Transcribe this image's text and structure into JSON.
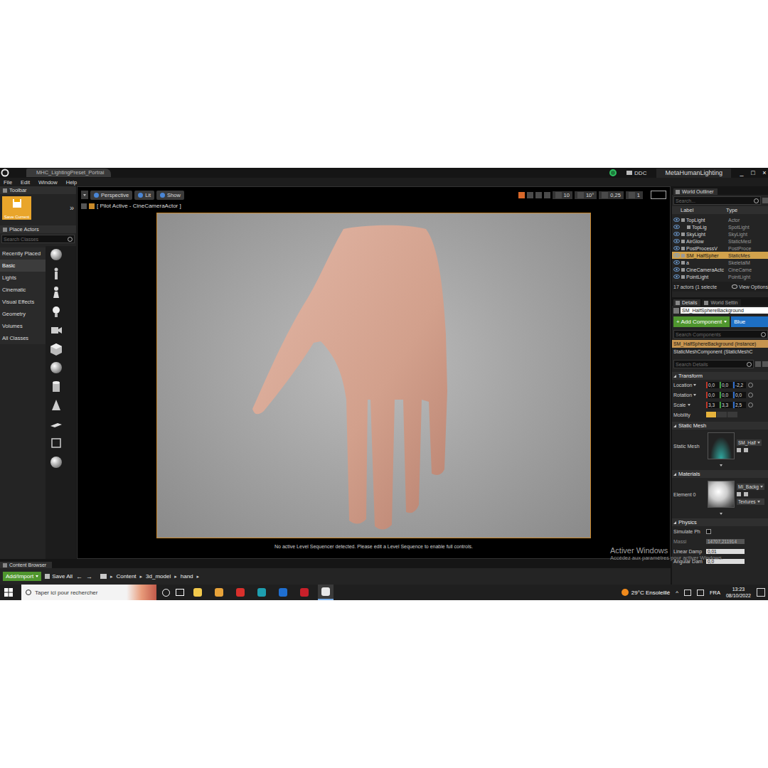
{
  "window": {
    "tab": "MHC_LightingPreset_Portrai",
    "ddc": "DDC",
    "project": "MetaHumanLighting",
    "controls": [
      "_",
      "□",
      "×"
    ]
  },
  "menu": [
    "File",
    "Edit",
    "Window",
    "Help"
  ],
  "left_panel": {
    "toolbar_title": "Toolbar",
    "save_label": "Save Current",
    "expand": "»",
    "place_title": "Place Actors",
    "search_placeholder": "Search Classes",
    "categories": [
      {
        "label": "Recently Placed",
        "selected": false
      },
      {
        "label": "Basic",
        "selected": true
      },
      {
        "label": "Lights",
        "selected": false
      },
      {
        "label": "Cinematic",
        "selected": false
      },
      {
        "label": "Visual Effects",
        "selected": false
      },
      {
        "label": "Geometry",
        "selected": false
      },
      {
        "label": "Volumes",
        "selected": false
      },
      {
        "label": "All Classes",
        "selected": false
      }
    ]
  },
  "viewport": {
    "buttons": [
      "Perspective",
      "Lit",
      "Show"
    ],
    "readouts": [
      "10",
      "10°",
      "0,25",
      "1"
    ],
    "pilot": "[ Pilot Active - CineCameraActor ]",
    "message": "No active Level Sequencer detected. Please edit a Level Sequence to enable full controls."
  },
  "outliner": {
    "tab": "World Outliner",
    "search_placeholder": "Search...",
    "columns": [
      "Label",
      "Type"
    ],
    "rows": [
      {
        "label": "TopLight",
        "type": "Actor",
        "child": false,
        "selected": false
      },
      {
        "label": "TopLig",
        "type": "SpotLight",
        "child": true,
        "selected": false
      },
      {
        "label": "SkyLight",
        "type": "SkyLight",
        "child": false,
        "selected": false
      },
      {
        "label": "AirGlow",
        "type": "StaticMesl",
        "child": false,
        "selected": false
      },
      {
        "label": "PostProcessV",
        "type": "PostProce",
        "child": false,
        "selected": false
      },
      {
        "label": "SM_HalfSpher",
        "type": "StaticMes",
        "child": false,
        "selected": true
      },
      {
        "label": "a",
        "type": "SkeletalM",
        "child": false,
        "selected": false
      },
      {
        "label": "CineCameraActc",
        "type": "CineCame",
        "child": false,
        "selected": false
      },
      {
        "label": "PointLight",
        "type": "PointLight",
        "child": false,
        "selected": false
      }
    ],
    "status": "17 actors (1 selecte",
    "view_options": "View Options"
  },
  "details": {
    "tabs": [
      {
        "label": "Details",
        "selected": true
      },
      {
        "label": "World Settin",
        "selected": false
      }
    ],
    "name": "SM_HalfSphereBackground",
    "add_component": "+ Add Component",
    "blueprint": "Blue",
    "search_components": "Search Components",
    "components": [
      {
        "label": "SM_HalfSphereBackground (Instance)",
        "selected": true
      },
      {
        "label": "StaticMeshComponent (StaticMeshC",
        "selected": false
      }
    ],
    "search_details": "Search Details",
    "transform": {
      "title": "Transform",
      "rows": [
        {
          "label": "Location",
          "values": [
            "0,0",
            "0,0",
            "-2,2"
          ]
        },
        {
          "label": "Rotation",
          "values": [
            "0,0",
            "0,0",
            "0,0"
          ]
        },
        {
          "label": "Scale",
          "values": [
            "3,3",
            "3,3",
            "2,5"
          ]
        }
      ],
      "mobility": "Mobility"
    },
    "static_mesh": {
      "title": "Static Mesh",
      "label": "Static Mesh",
      "asset": "SM_Half"
    },
    "materials": {
      "title": "Materials",
      "label": "Element 0",
      "asset": "MI_Backg",
      "textures": "Textures"
    },
    "physics": {
      "title": "Physics",
      "rows": [
        {
          "label": "Simulate Ph",
          "kind": "checkbox",
          "checked": false,
          "disabled": false
        },
        {
          "label": "Massi",
          "kind": "field",
          "value": "14707,211914",
          "disabled": true
        },
        {
          "label": "Linear Damp",
          "kind": "field",
          "value": "0,01",
          "disabled": false
        },
        {
          "label": "Angular Dam",
          "kind": "field",
          "value": "0,0",
          "disabled": false
        }
      ]
    }
  },
  "watermark": {
    "title": "Activer Windows",
    "subtitle": "Accédez aux paramètres pour activer Windows."
  },
  "content_browser": {
    "tab": "Content Browser",
    "add_import": "Add/Import",
    "save_all": "Save All",
    "back": "←",
    "forward": "→",
    "separator": "▸",
    "path": [
      "Content",
      "3d_model",
      "hand"
    ]
  },
  "taskbar": {
    "search": "Taper ici pour rechercher",
    "apps": [
      {
        "color": "#f2c94c",
        "selected": false
      },
      {
        "color": "#e8a33a",
        "selected": false
      },
      {
        "color": "#d9302c",
        "selected": false
      },
      {
        "color": "#1e9fb0",
        "selected": false
      },
      {
        "color": "#1f6fd1",
        "selected": false
      },
      {
        "color": "#c8202a",
        "selected": false
      },
      {
        "color": "#e8e8e8",
        "selected": true
      }
    ],
    "weather": "29°C Ensoleillé",
    "tray": "^",
    "lang": "FRA",
    "time": "13:23",
    "date": "08/10/2022"
  }
}
